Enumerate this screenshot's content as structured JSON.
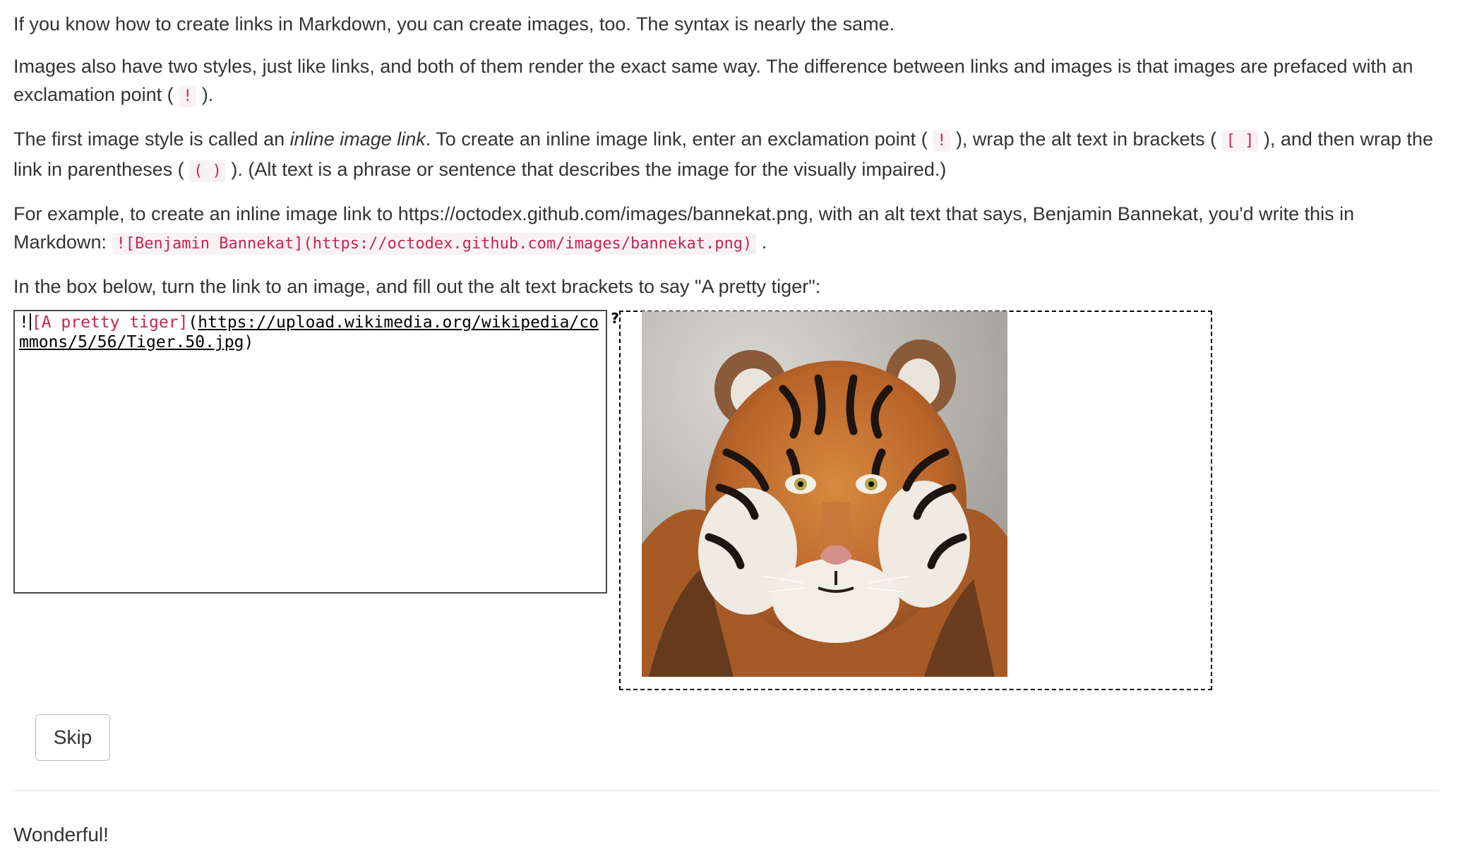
{
  "lesson": {
    "p1": "If you know how to create links in Markdown, you can create images, too. The syntax is nearly the same.",
    "p2_before": "Images also have two styles, just like links, and both of them render the exact same way. The difference between links and images is that images are prefaced with an exclamation point ( ",
    "p2_code": "!",
    "p2_after": " ).",
    "p3_a": "The first image style is called an ",
    "p3_em": "inline image link",
    "p3_b": ". To create an inline image link, enter an exclamation point ( ",
    "p3_code1": "!",
    "p3_c": " ), wrap the alt text in brackets ( ",
    "p3_code2": "[ ]",
    "p3_d": " ), and then wrap the link in parentheses ( ",
    "p3_code3": "( )",
    "p3_e": " ). (Alt text is a phrase or sentence that describes the image for the visually impaired.)",
    "p4_a": "For example, to create an inline image link to https://octodex.github.com/images/bannekat.png, with an alt text that says, Benjamin Bannekat, you'd write this in Markdown: ",
    "p4_code": "![Benjamin Bannekat](https://octodex.github.com/images/bannekat.png)",
    "p4_b": " .",
    "p5": "In the box below, turn the link to an image, and fill out the alt text brackets to say \"A pretty tiger\":"
  },
  "editor": {
    "bang": "!",
    "alt": "[A pretty tiger]",
    "open_paren": "(",
    "url": "https://upload.wikimedia.org/wikipedia/commons/5/56/Tiger.50.jpg",
    "close_paren": ")"
  },
  "preview": {
    "broken_icon": "?",
    "image_icon": "tiger-photo"
  },
  "buttons": {
    "skip": "Skip"
  },
  "result": {
    "message": "Wonderful!"
  }
}
